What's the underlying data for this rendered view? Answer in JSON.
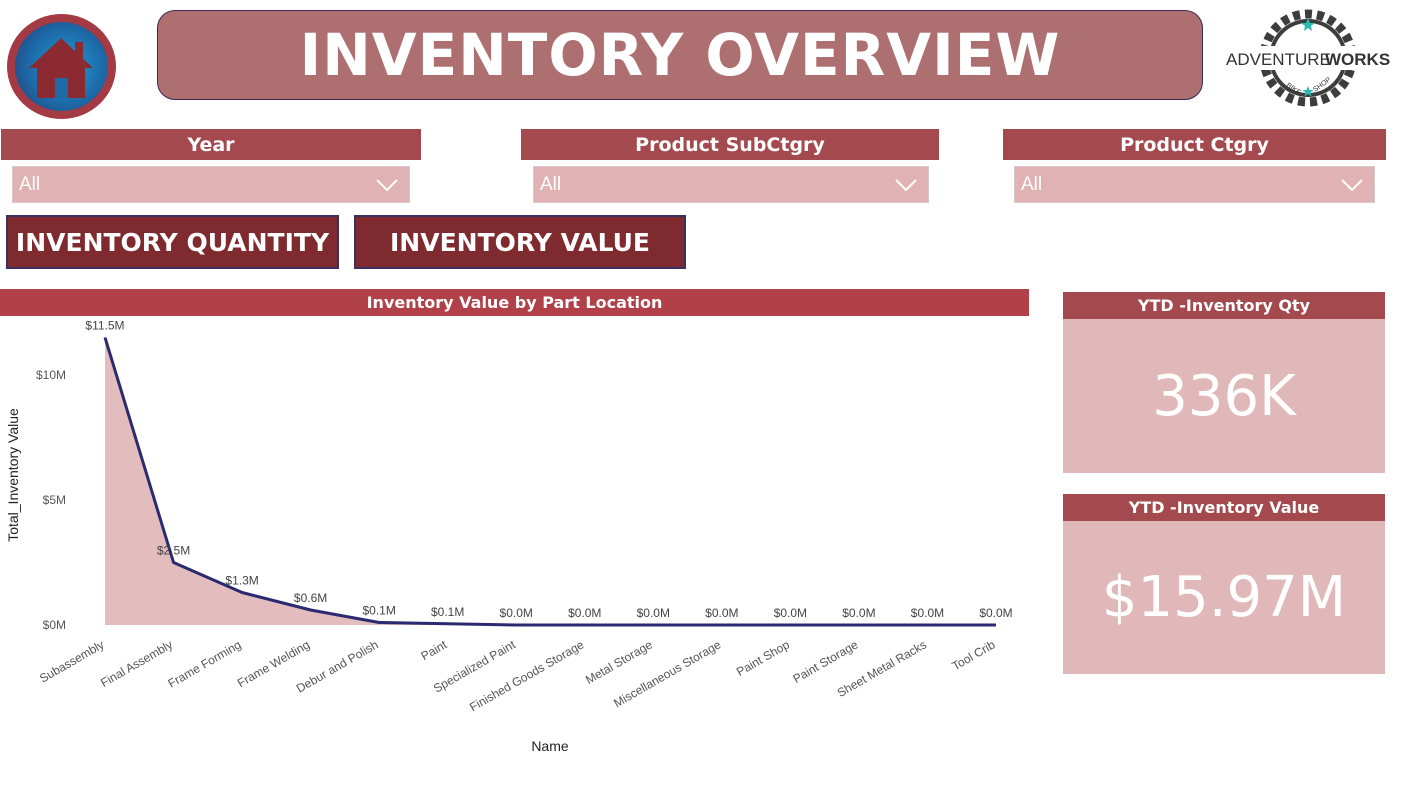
{
  "header": {
    "title": "INVENTORY OVERVIEW",
    "logo_text_left": "ADVENTURE",
    "logo_text_right": "WORKS",
    "logo_sub_left": "BIKE",
    "logo_sub_right": "SHOP"
  },
  "slicers": [
    {
      "label": "Year",
      "value": "All"
    },
    {
      "label": "Product SubCtgry",
      "value": "All"
    },
    {
      "label": "Product Ctgry",
      "value": "All"
    }
  ],
  "buttons": {
    "inventory_quantity": "INVENTORY QUANTITY",
    "inventory_value": "INVENTORY VALUE"
  },
  "kpis": [
    {
      "title": "YTD -Inventory Qty",
      "value": "336K"
    },
    {
      "title": "YTD -Inventory Value",
      "value": "$15.97M"
    }
  ],
  "colors": {
    "line": "#2b2a70",
    "area": "#e3bcbd",
    "accent": "#a44a4f"
  },
  "chart_data": {
    "type": "area",
    "title": "Inventory Value by Part Location",
    "xlabel": "Name",
    "ylabel": "Total_Inventory Value",
    "ylim": [
      0,
      12000000
    ],
    "yticks": [
      {
        "value": 0,
        "label": "$0M"
      },
      {
        "value": 5000000,
        "label": "$5M"
      },
      {
        "value": 10000000,
        "label": "$10M"
      }
    ],
    "categories": [
      "Subassembly",
      "Final Assembly",
      "Frame Forming",
      "Frame Welding",
      "Debur and Polish",
      "Paint",
      "Specialized Paint",
      "Finished Goods Storage",
      "Metal Storage",
      "Miscellaneous Storage",
      "Paint Shop",
      "Paint Storage",
      "Sheet Metal Racks",
      "Tool Crib"
    ],
    "values": [
      11500000,
      2500000,
      1300000,
      600000,
      100000,
      50000,
      0,
      0,
      0,
      0,
      0,
      0,
      0,
      0
    ],
    "data_labels": [
      "$11.5M",
      "$2.5M",
      "$1.3M",
      "$0.6M",
      "$0.1M",
      "$0.1M",
      "$0.0M",
      "$0.0M",
      "$0.0M",
      "$0.0M",
      "$0.0M",
      "$0.0M",
      "$0.0M",
      "$0.0M"
    ],
    "grid": false,
    "legend": "none"
  }
}
